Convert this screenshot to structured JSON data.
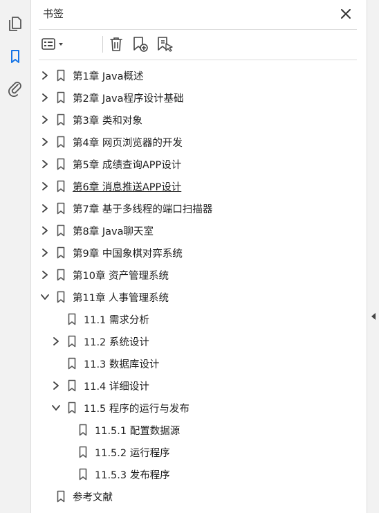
{
  "panel": {
    "title": "书签"
  },
  "rail": {
    "icons": [
      "pages-icon",
      "bookmark-icon",
      "attachment-icon"
    ]
  },
  "toolbar": {
    "icons": [
      "options-menu-icon",
      "delete-icon",
      "new-bookmark-icon",
      "bookmark-from-selection-icon"
    ]
  },
  "tree": [
    {
      "label": "第1章 Java概述",
      "level": 0,
      "expander": "collapsed"
    },
    {
      "label": "第2章 Java程序设计基础",
      "level": 0,
      "expander": "collapsed"
    },
    {
      "label": "第3章 类和对象",
      "level": 0,
      "expander": "collapsed"
    },
    {
      "label": "第4章 网页浏览器的开发",
      "level": 0,
      "expander": "collapsed"
    },
    {
      "label": "第5章 成绩查询APP设计",
      "level": 0,
      "expander": "collapsed"
    },
    {
      "label": "第6章 消息推送APP设计",
      "level": 0,
      "expander": "collapsed",
      "underline": true
    },
    {
      "label": "第7章 基于多线程的端口扫描器",
      "level": 0,
      "expander": "collapsed"
    },
    {
      "label": "第8章 Java聊天室",
      "level": 0,
      "expander": "collapsed"
    },
    {
      "label": "第9章 中国象棋对弈系统",
      "level": 0,
      "expander": "collapsed"
    },
    {
      "label": "第10章 资产管理系统",
      "level": 0,
      "expander": "collapsed"
    },
    {
      "label": "第11章 人事管理系统",
      "level": 0,
      "expander": "expanded"
    },
    {
      "label": "11.1 需求分析",
      "level": 1,
      "expander": "none"
    },
    {
      "label": "11.2 系统设计",
      "level": 1,
      "expander": "collapsed"
    },
    {
      "label": "11.3 数据库设计",
      "level": 1,
      "expander": "none"
    },
    {
      "label": "11.4 详细设计",
      "level": 1,
      "expander": "collapsed"
    },
    {
      "label": "11.5 程序的运行与发布",
      "level": 1,
      "expander": "expanded"
    },
    {
      "label": "11.5.1 配置数据源",
      "level": 2,
      "expander": "none"
    },
    {
      "label": "11.5.2 运行程序",
      "level": 2,
      "expander": "none"
    },
    {
      "label": "11.5.3 发布程序",
      "level": 2,
      "expander": "none"
    },
    {
      "label": "参考文献",
      "level": 0,
      "expander": "none"
    }
  ]
}
